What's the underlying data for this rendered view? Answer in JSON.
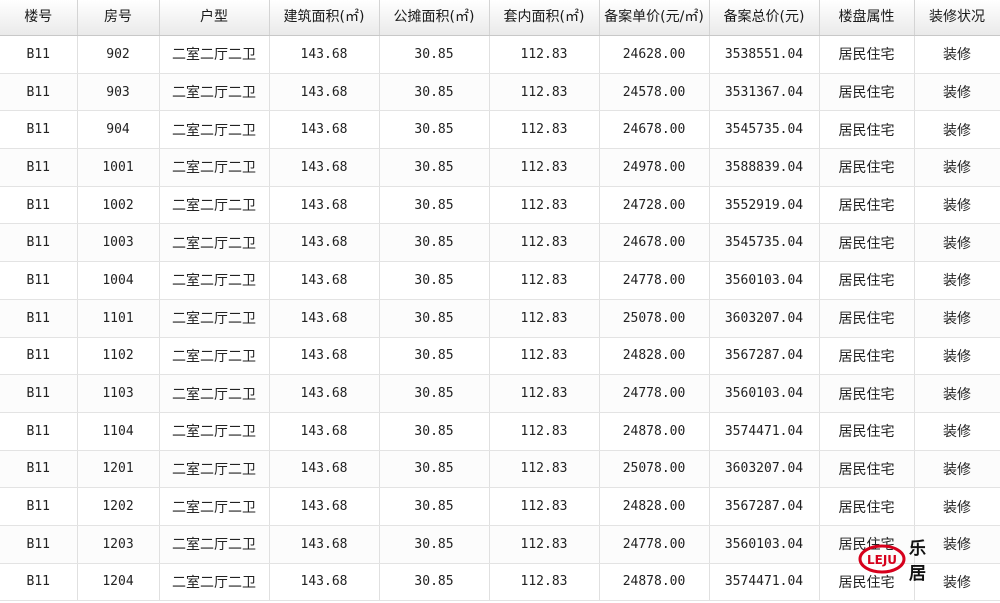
{
  "table": {
    "headers": [
      "楼号",
      "房号",
      "户型",
      "建筑面积(㎡)",
      "公摊面积(㎡)",
      "套内面积(㎡)",
      "备案单价(元/㎡)",
      "备案总价(元)",
      "楼盘属性",
      "装修状况"
    ],
    "rows": [
      [
        "B11",
        "902",
        "二室二厅二卫",
        "143.68",
        "30.85",
        "112.83",
        "24628.00",
        "3538551.04",
        "居民住宅",
        "装修"
      ],
      [
        "B11",
        "903",
        "二室二厅二卫",
        "143.68",
        "30.85",
        "112.83",
        "24578.00",
        "3531367.04",
        "居民住宅",
        "装修"
      ],
      [
        "B11",
        "904",
        "二室二厅二卫",
        "143.68",
        "30.85",
        "112.83",
        "24678.00",
        "3545735.04",
        "居民住宅",
        "装修"
      ],
      [
        "B11",
        "1001",
        "二室二厅二卫",
        "143.68",
        "30.85",
        "112.83",
        "24978.00",
        "3588839.04",
        "居民住宅",
        "装修"
      ],
      [
        "B11",
        "1002",
        "二室二厅二卫",
        "143.68",
        "30.85",
        "112.83",
        "24728.00",
        "3552919.04",
        "居民住宅",
        "装修"
      ],
      [
        "B11",
        "1003",
        "二室二厅二卫",
        "143.68",
        "30.85",
        "112.83",
        "24678.00",
        "3545735.04",
        "居民住宅",
        "装修"
      ],
      [
        "B11",
        "1004",
        "二室二厅二卫",
        "143.68",
        "30.85",
        "112.83",
        "24778.00",
        "3560103.04",
        "居民住宅",
        "装修"
      ],
      [
        "B11",
        "1101",
        "二室二厅二卫",
        "143.68",
        "30.85",
        "112.83",
        "25078.00",
        "3603207.04",
        "居民住宅",
        "装修"
      ],
      [
        "B11",
        "1102",
        "二室二厅二卫",
        "143.68",
        "30.85",
        "112.83",
        "24828.00",
        "3567287.04",
        "居民住宅",
        "装修"
      ],
      [
        "B11",
        "1103",
        "二室二厅二卫",
        "143.68",
        "30.85",
        "112.83",
        "24778.00",
        "3560103.04",
        "居民住宅",
        "装修"
      ],
      [
        "B11",
        "1104",
        "二室二厅二卫",
        "143.68",
        "30.85",
        "112.83",
        "24878.00",
        "3574471.04",
        "居民住宅",
        "装修"
      ],
      [
        "B11",
        "1201",
        "二室二厅二卫",
        "143.68",
        "30.85",
        "112.83",
        "25078.00",
        "3603207.04",
        "居民住宅",
        "装修"
      ],
      [
        "B11",
        "1202",
        "二室二厅二卫",
        "143.68",
        "30.85",
        "112.83",
        "24828.00",
        "3567287.04",
        "居民住宅",
        "装修"
      ],
      [
        "B11",
        "1203",
        "二室二厅二卫",
        "143.68",
        "30.85",
        "112.83",
        "24778.00",
        "3560103.04",
        "居民住宅",
        "装修"
      ],
      [
        "B11",
        "1204",
        "二室二厅二卫",
        "143.68",
        "30.85",
        "112.83",
        "24878.00",
        "3574471.04",
        "居民住宅",
        "装修"
      ]
    ]
  },
  "watermark": {
    "logo_text": "LEJU",
    "brand_text": "乐居",
    "color": "#d6001c",
    "icon": "leju-logo-icon"
  }
}
